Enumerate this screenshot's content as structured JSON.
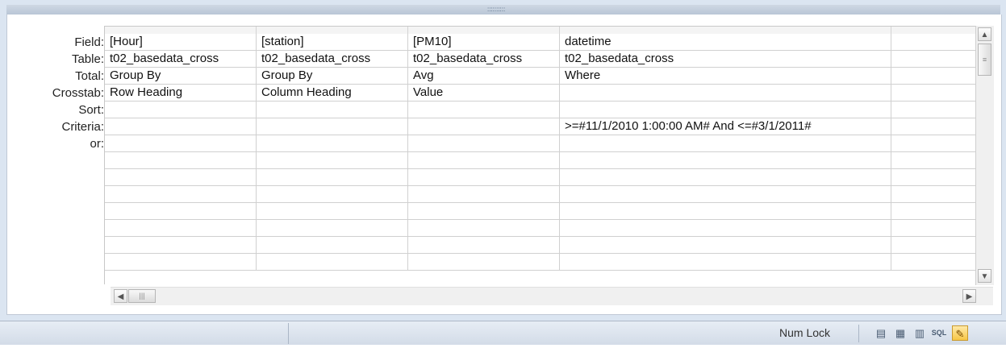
{
  "row_labels": [
    "Field:",
    "Table:",
    "Total:",
    "Crosstab:",
    "Sort:",
    "Criteria:",
    "or:"
  ],
  "columns": [
    {
      "field": "[Hour]",
      "table": "t02_basedata_cross",
      "total": "Group By",
      "crosstab": "Row Heading",
      "sort": "",
      "criteria": "",
      "or": ""
    },
    {
      "field": "[station]",
      "table": "t02_basedata_cross",
      "total": "Group By",
      "crosstab": "Column Heading",
      "sort": "",
      "criteria": "",
      "or": ""
    },
    {
      "field": "[PM10]",
      "table": "t02_basedata_cross",
      "total": "Avg",
      "crosstab": "Value",
      "sort": "",
      "criteria": "",
      "or": ""
    },
    {
      "field": "datetime",
      "table": "t02_basedata_cross",
      "total": "Where",
      "crosstab": "",
      "sort": "",
      "criteria": ">=#11/1/2010 1:00:00 AM# And <=#3/1/2011#",
      "or": ""
    },
    {
      "field": "",
      "table": "",
      "total": "",
      "crosstab": "",
      "sort": "",
      "criteria": "",
      "or": ""
    }
  ],
  "status": {
    "num_lock": "Num Lock"
  },
  "view_buttons": [
    {
      "icon": "datasheet-view-icon",
      "glyph": "▤"
    },
    {
      "icon": "pivottable-view-icon",
      "glyph": "▦"
    },
    {
      "icon": "pivotchart-view-icon",
      "glyph": "▥"
    },
    {
      "icon": "sql-view-icon",
      "glyph": "SQL"
    },
    {
      "icon": "design-view-icon",
      "glyph": "✎"
    }
  ],
  "splitter_grip": "::::::::::"
}
